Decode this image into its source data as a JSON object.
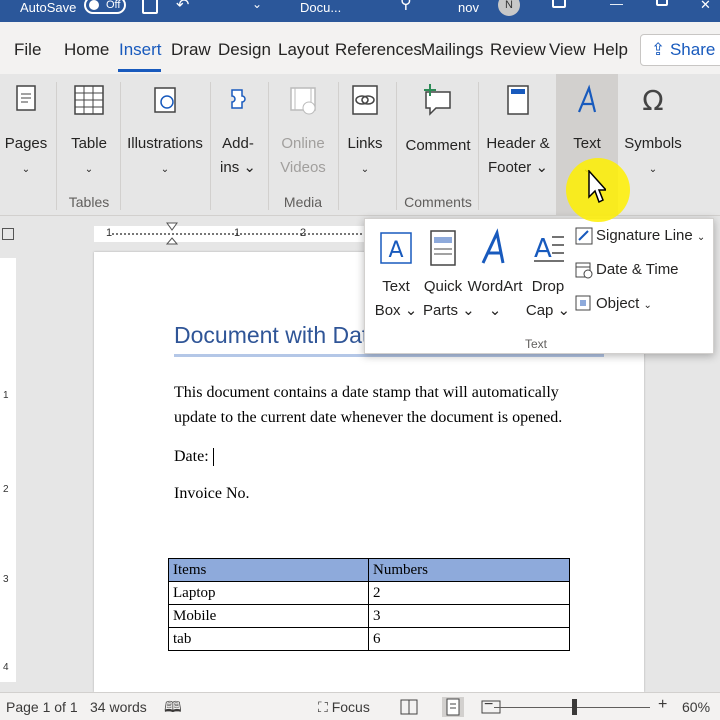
{
  "titlebar": {
    "autosave_label": "AutoSave",
    "autosave_state": "Off",
    "doc_name": "Docu...",
    "user_name": "nov",
    "user_initial": "N"
  },
  "tabs": [
    {
      "label": "File"
    },
    {
      "label": "Home"
    },
    {
      "label": "Insert"
    },
    {
      "label": "Draw"
    },
    {
      "label": "Design"
    },
    {
      "label": "Layout"
    },
    {
      "label": "References"
    },
    {
      "label": "Mailings"
    },
    {
      "label": "Review"
    },
    {
      "label": "View"
    },
    {
      "label": "Help"
    }
  ],
  "share_label": "Share",
  "ribbon": {
    "pages": {
      "label": "Pages",
      "chev": "⌄"
    },
    "table": {
      "label": "Table",
      "chev": "⌄"
    },
    "illustrations": {
      "label": "Illustrations",
      "chev": "⌄"
    },
    "addins": {
      "label1": "Add-",
      "label2": "ins ⌄"
    },
    "online_videos": {
      "label1": "Online",
      "label2": "Videos"
    },
    "links": {
      "label": "Links",
      "chev": "⌄"
    },
    "comment": {
      "label": "Comment"
    },
    "header_footer": {
      "label1": "Header &",
      "label2": "Footer ⌄"
    },
    "text": {
      "label": "Text",
      "chev": "⌄"
    },
    "symbols": {
      "label": "Symbols",
      "chev": "⌄"
    },
    "groups": {
      "tables": "Tables",
      "media": "Media",
      "comments": "Comments"
    }
  },
  "dropdown": {
    "text_box": {
      "label1": "Text",
      "label2": "Box ⌄"
    },
    "quick_parts": {
      "label1": "Quick",
      "label2": "Parts ⌄"
    },
    "wordart": {
      "label1": "WordArt",
      "label2": "⌄"
    },
    "drop_cap": {
      "label1": "Drop",
      "label2": "Cap ⌄"
    },
    "signature_line": "Signature Line",
    "date_time": "Date & Time",
    "object": "Object",
    "group_label": "Text"
  },
  "document": {
    "title": "Document with Date",
    "paragraph_line1": "This document contains a date stamp that will automatically",
    "paragraph_line2": "update to the current date whenever the document is opened.",
    "date_label": "Date:",
    "invoice_label": "Invoice No.",
    "table": {
      "headers": [
        "Items",
        "Numbers"
      ],
      "rows": [
        [
          "Laptop",
          "2"
        ],
        [
          "Mobile",
          "3"
        ],
        [
          "tab",
          "6"
        ]
      ]
    }
  },
  "ruler": {
    "marks": [
      "1",
      "1",
      "2"
    ]
  },
  "vruler": {
    "marks": [
      "1",
      "2",
      "3",
      "4"
    ]
  },
  "statusbar": {
    "page_info": "Page 1 of 1",
    "word_count": "34 words",
    "focus_label": "Focus",
    "zoom_minus": "−",
    "zoom_plus": "+",
    "zoom_level": "60%"
  },
  "colors": {
    "accent": "#185abd",
    "titlebar": "#2b579a",
    "table_header": "#8eaadb",
    "heading": "#2f5597",
    "pointer_highlight": "#fff000"
  }
}
